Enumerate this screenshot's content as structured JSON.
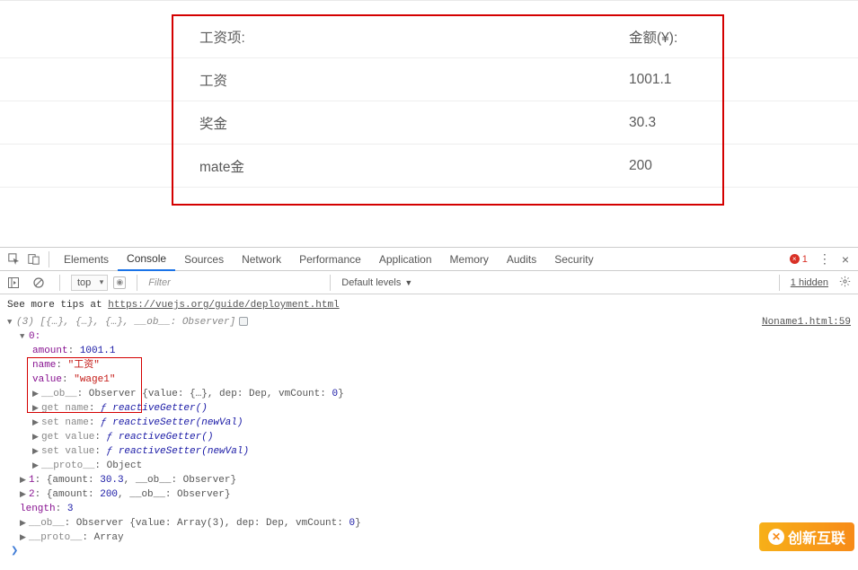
{
  "page": {
    "header_label": "工资项:",
    "header_value": "金额(¥):",
    "rows": [
      {
        "label": "工资",
        "value": "1001.1"
      },
      {
        "label": "奖金",
        "value": "30.3"
      },
      {
        "label": "mate金",
        "value": "200"
      }
    ]
  },
  "devtools": {
    "tabs": [
      "Elements",
      "Console",
      "Sources",
      "Network",
      "Performance",
      "Application",
      "Memory",
      "Audits",
      "Security"
    ],
    "active_tab": "Console",
    "error_count": "1",
    "context": "top",
    "filter_placeholder": "Filter",
    "levels": "Default levels",
    "hidden": "1 hidden",
    "tips_prefix": "See more tips at ",
    "tips_url": "https://vuejs.org/guide/deployment.html",
    "source_link": "Noname1.html:59",
    "summary": "(3) [{…}, {…}, {…}, __ob__: Observer]",
    "idx0_label": "0:",
    "obj0": {
      "amount_key": "amount",
      "amount_val": "1001.1",
      "name_key": "name",
      "name_val": "\"工资\"",
      "value_key": "value",
      "value_val": "\"wage1\""
    },
    "ob_line": "__ob__: Observer {value: {…}, dep: Dep, vmCount: 0}",
    "get_name": "get name: ƒ reactiveGetter()",
    "set_name": "set name: ƒ reactiveSetter(newVal)",
    "get_value": "get value: ƒ reactiveGetter()",
    "set_value": "set value: ƒ reactiveSetter(newVal)",
    "proto0": "__proto__: Object",
    "idx1": "1: {amount: 30.3, __ob__: Observer}",
    "idx2": "2: {amount: 200, __ob__: Observer}",
    "length": "length: 3",
    "ob_arr": "__ob__: Observer {value: Array(3), dep: Dep, vmCount: 0}",
    "proto_arr": "__proto__: Array"
  },
  "watermark": "创新互联"
}
